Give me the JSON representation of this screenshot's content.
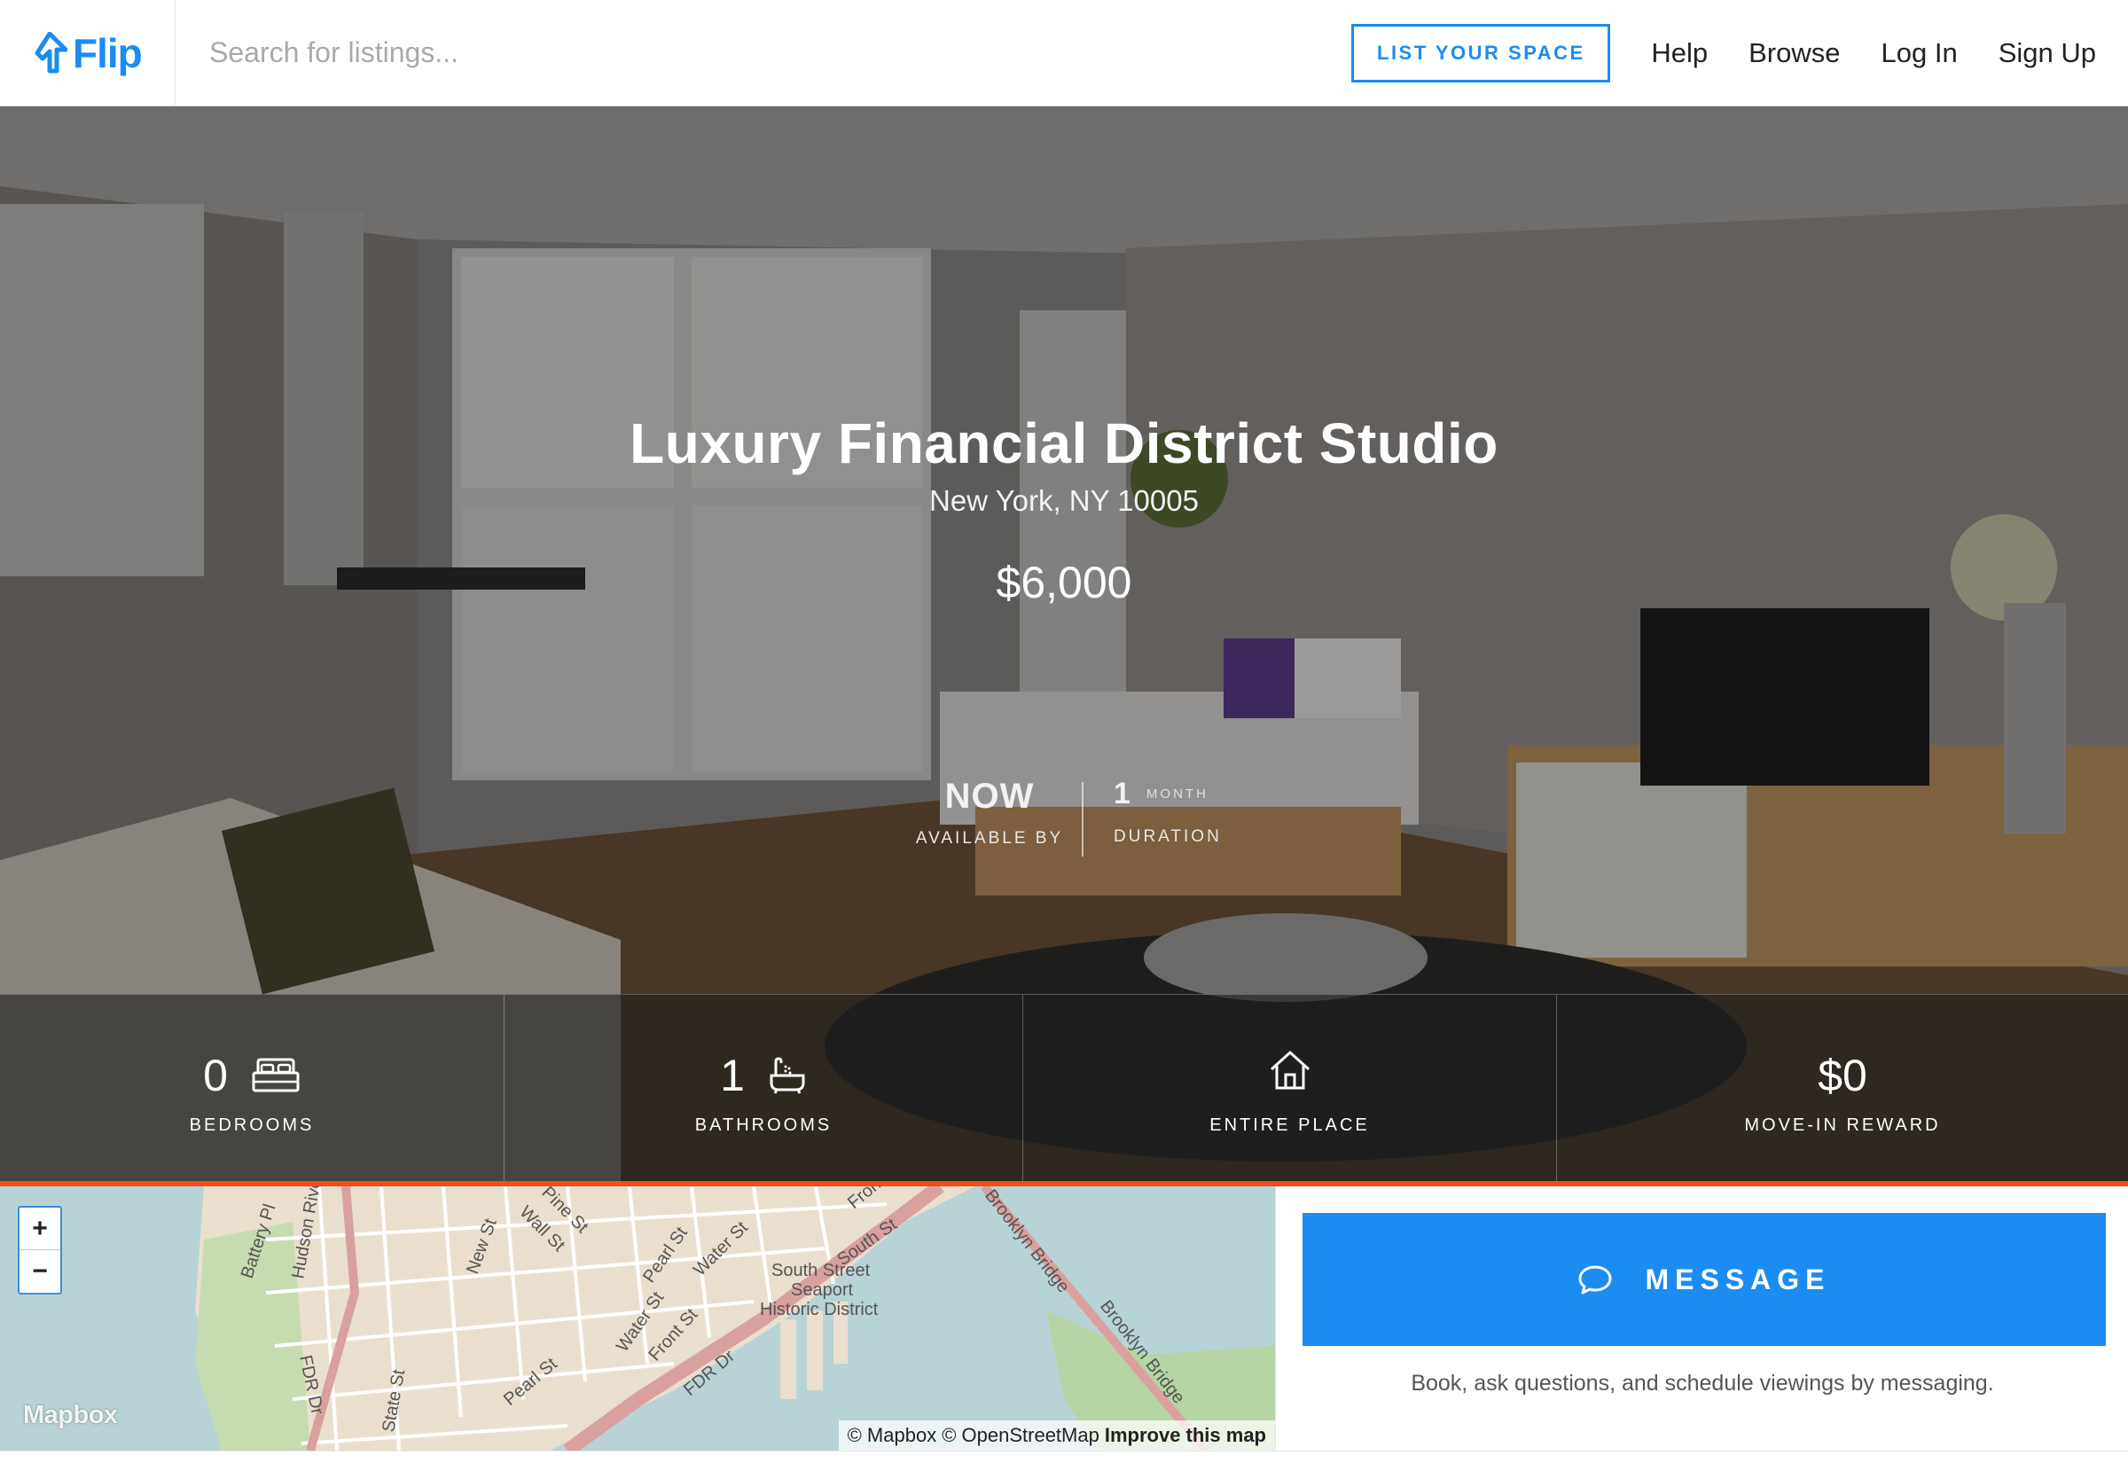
{
  "nav": {
    "logo_text": "Flip",
    "search_placeholder": "Search for listings...",
    "list_button": "LIST YOUR SPACE",
    "links": [
      "Help",
      "Browse",
      "Log In",
      "Sign Up"
    ]
  },
  "listing": {
    "title": "Luxury Financial District Studio",
    "address": "New York, NY 10005",
    "price": "$6,000",
    "availability": {
      "value": "NOW",
      "label": "AVAILABLE BY"
    },
    "duration": {
      "value": "1",
      "unit": "MONTH",
      "label": "DURATION"
    }
  },
  "stats": [
    {
      "value": "0",
      "label": "BEDROOMS",
      "icon": "bed-icon"
    },
    {
      "value": "1",
      "label": "BATHROOMS",
      "icon": "bathtub-icon"
    },
    {
      "value": "",
      "label": "ENTIRE PLACE",
      "icon": "house-icon"
    },
    {
      "value": "$0",
      "label": "MOVE-IN REWARD",
      "icon": ""
    }
  ],
  "map": {
    "zoom_in": "+",
    "zoom_out": "−",
    "brand": "Mapbox",
    "attribution": {
      "mapbox": "© Mapbox",
      "osm": "© OpenStreetMap",
      "improve": "Improve this map"
    },
    "labels": {
      "district_1": "South Street",
      "district_2": "Seaport",
      "district_3": "Historic District",
      "bridge_1": "Brooklyn Bridge",
      "bridge_2": "Brooklyn Bridge",
      "street_pearl_1": "Pearl St",
      "street_pearl_2": "Pearl St",
      "street_water_1": "Water St",
      "street_water_2": "Water St",
      "street_wall": "Wall St",
      "street_pine": "Pine St",
      "street_new": "New St",
      "street_front_1": "Front St",
      "street_front_2": "Front St",
      "street_south": "South St",
      "street_fdr_1": "FDR Dr",
      "street_fdr_2": "FDR Dr",
      "street_battery": "Battery Pl",
      "street_hudson": "Hudson River",
      "street_state": "State St"
    }
  },
  "message": {
    "button_label": "MESSAGE",
    "note": "Book, ask questions, and schedule viewings by messaging."
  },
  "colors": {
    "brand_blue": "#1b8cf2",
    "accent_orange": "#f04e1a"
  }
}
